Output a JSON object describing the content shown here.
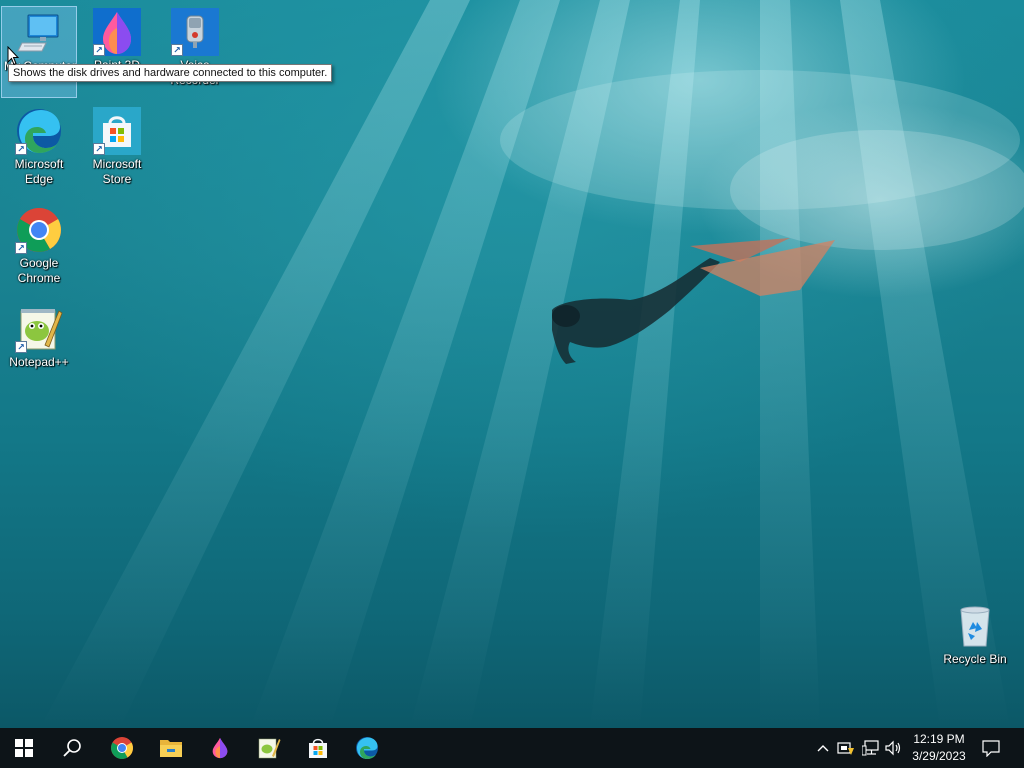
{
  "desktop": {
    "icons": [
      {
        "label": "My Computer",
        "icon": "computer-icon"
      },
      {
        "label": "Paint 3D",
        "icon": "paint3d-icon"
      },
      {
        "label": "Voice Recorder",
        "icon": "voice-recorder-icon"
      },
      {
        "label": "Microsoft Edge",
        "icon": "edge-icon"
      },
      {
        "label": "Microsoft Store",
        "icon": "store-icon"
      },
      {
        "label": "Google Chrome",
        "icon": "chrome-icon"
      },
      {
        "label": "Notepad++",
        "icon": "notepadpp-icon"
      },
      {
        "label": "Recycle Bin",
        "icon": "recycle-bin-icon"
      }
    ],
    "tooltip": "Shows the disk drives and hardware connected to this computer."
  },
  "taskbar": {
    "pinned": [
      "windows-start-icon",
      "search-icon",
      "chrome-icon",
      "file-explorer-icon",
      "paint3d-icon",
      "notepadpp-icon",
      "store-icon",
      "edge-icon"
    ],
    "clock": {
      "time": "12:19 PM",
      "date": "3/29/2023"
    }
  },
  "colors": {
    "taskbar": "#0d1418",
    "water": "#1a8392",
    "accent": "#0078d4"
  }
}
